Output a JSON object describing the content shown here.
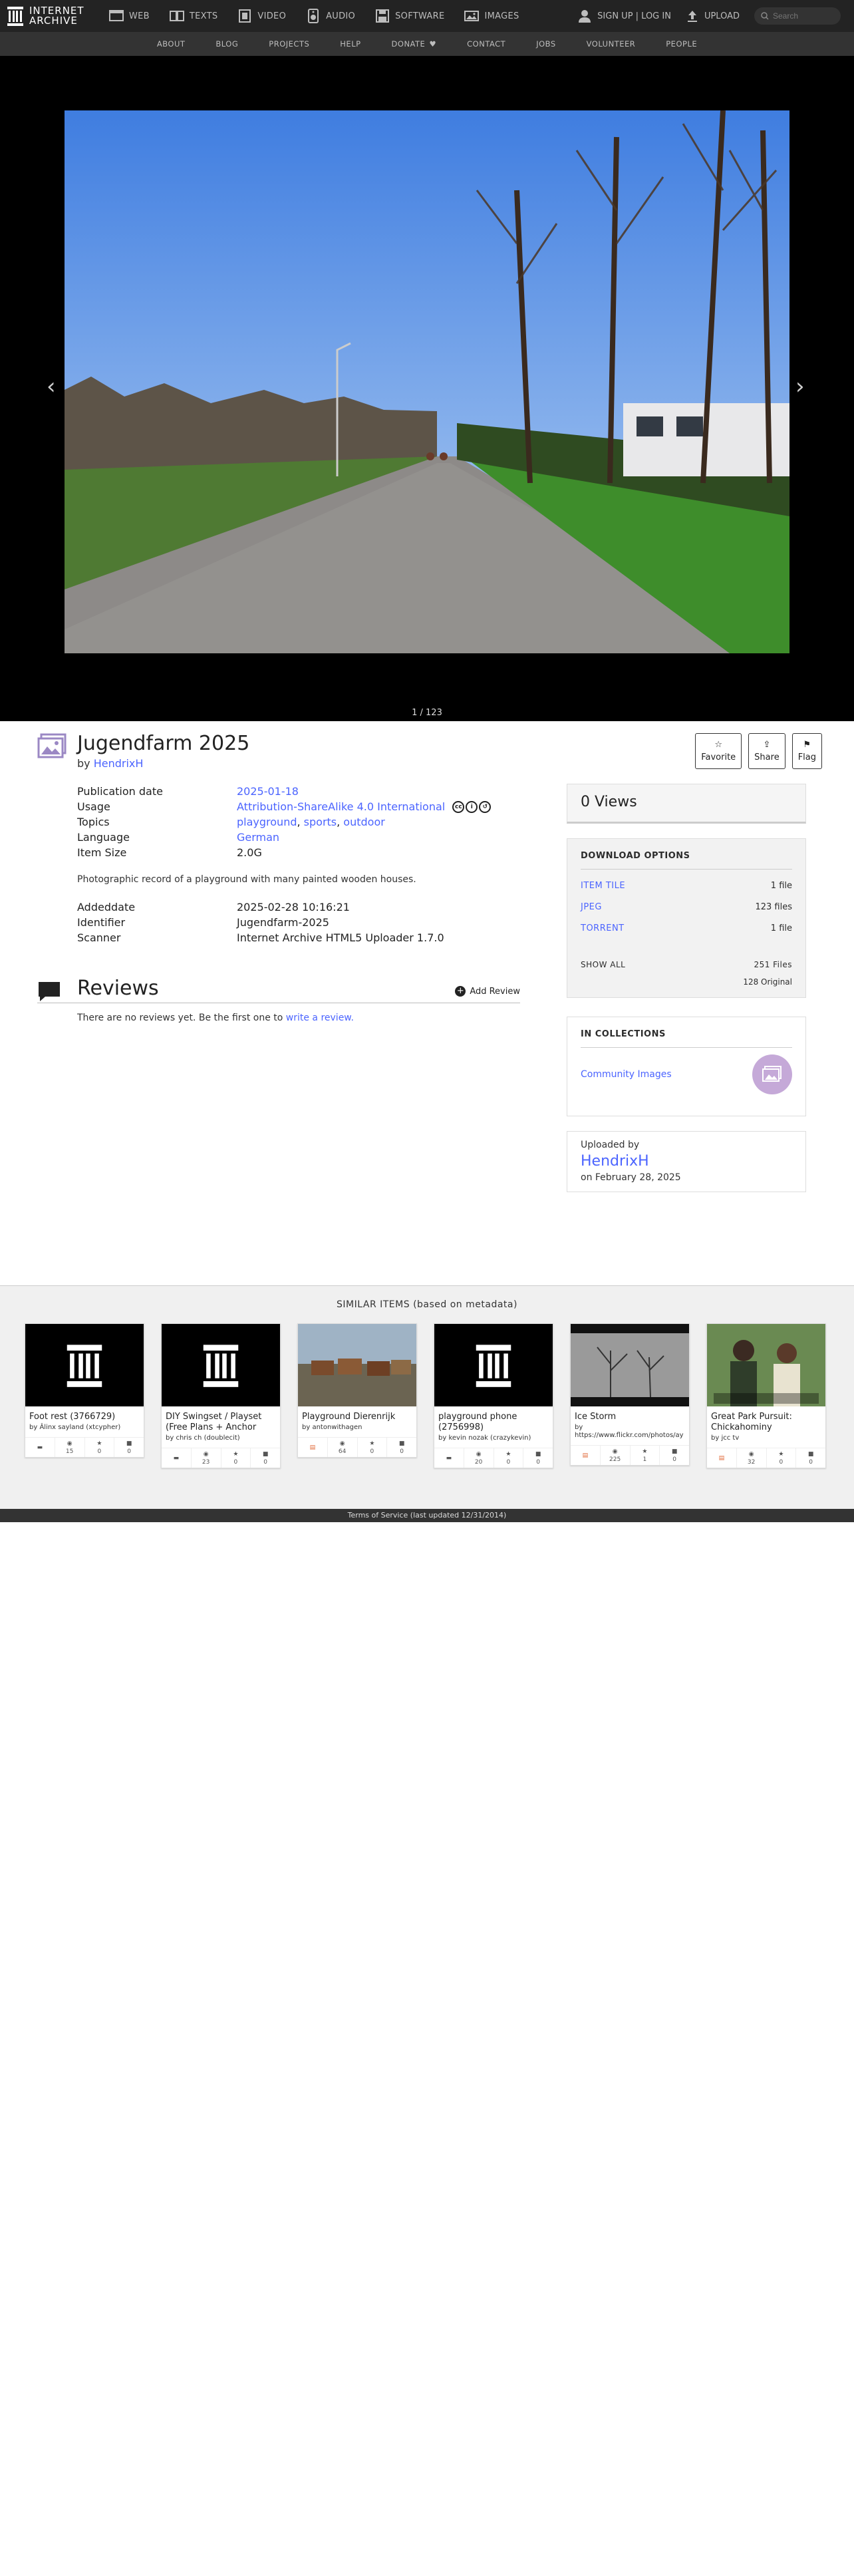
{
  "header": {
    "logo_line1": "INTERNET",
    "logo_line2": "ARCHIVE",
    "nav": [
      {
        "label": "WEB",
        "icon": "web-icon"
      },
      {
        "label": "TEXTS",
        "icon": "book-icon"
      },
      {
        "label": "VIDEO",
        "icon": "film-icon"
      },
      {
        "label": "AUDIO",
        "icon": "speaker-icon"
      },
      {
        "label": "SOFTWARE",
        "icon": "floppy-icon"
      },
      {
        "label": "IMAGES",
        "icon": "image-icon"
      }
    ],
    "signup": "SIGN UP | LOG IN",
    "upload": "UPLOAD",
    "search_placeholder": "Search"
  },
  "subnav": [
    "ABOUT",
    "BLOG",
    "PROJECTS",
    "HELP",
    "DONATE",
    "CONTACT",
    "JOBS",
    "VOLUNTEER",
    "PEOPLE"
  ],
  "theater": {
    "counter": "1 / 123"
  },
  "item": {
    "title": "Jugendfarm 2025",
    "by_prefix": "by",
    "author": "HendrixH",
    "actions": [
      "Favorite",
      "Share",
      "Flag"
    ]
  },
  "metadata": {
    "publication_date_label": "Publication date",
    "publication_date": "2025-01-18",
    "usage_label": "Usage",
    "usage": "Attribution-ShareAlike 4.0 International",
    "topics_label": "Topics",
    "topics": [
      "playground",
      "sports",
      "outdoor"
    ],
    "language_label": "Language",
    "language": "German",
    "item_size_label": "Item Size",
    "item_size": "2.0G",
    "description": "Photographic record of a playground with many painted wooden houses.",
    "addeddate_label": "Addeddate",
    "addeddate": "2025-02-28 10:16:21",
    "identifier_label": "Identifier",
    "identifier": "Jugendfarm-2025",
    "scanner_label": "Scanner",
    "scanner": "Internet Archive HTML5 Uploader 1.7.0"
  },
  "reviews": {
    "title": "Reviews",
    "add": "Add Review",
    "empty_text": "There are no reviews yet. Be the first one to",
    "empty_link": "write a review."
  },
  "views": "0 Views",
  "downloads": {
    "title": "DOWNLOAD OPTIONS",
    "rows": [
      {
        "label": "ITEM TILE",
        "count": "1 file"
      },
      {
        "label": "JPEG",
        "count": "123 files"
      },
      {
        "label": "TORRENT",
        "count": "1 file"
      }
    ],
    "show_all": "SHOW ALL",
    "total": "251 Files",
    "original": "128 Original"
  },
  "collections": {
    "title": "IN COLLECTIONS",
    "items": [
      "Community Images"
    ]
  },
  "uploader": {
    "label": "Uploaded by",
    "name": "HendrixH",
    "date": "on February 28, 2025"
  },
  "similar": {
    "title": "SIMILAR ITEMS (based on metadata)",
    "tiles": [
      {
        "title": "Foot rest (3766729)",
        "by": "by Âlinx sayland (xtcypher)",
        "views": "15",
        "favs": "0",
        "reviews": "0",
        "type": "folder"
      },
      {
        "title": "DIY Swingset / Playset (Free Plans + Anchor",
        "by": "by chris ch (doublecit)",
        "views": "23",
        "favs": "0",
        "reviews": "0",
        "type": "folder"
      },
      {
        "title": "Playground Dierenrijk",
        "by": "by antonwithagen",
        "views": "64",
        "favs": "0",
        "reviews": "0",
        "type": "film"
      },
      {
        "title": "playground phone (2756998)",
        "by": "by kevin nozak (crazykevin)",
        "views": "20",
        "favs": "0",
        "reviews": "0",
        "type": "folder"
      },
      {
        "title": "Ice Storm",
        "by": "by https://www.flickr.com/photos/ay",
        "views": "225",
        "favs": "1",
        "reviews": "0",
        "type": "film"
      },
      {
        "title": "Great Park Pursuit: Chickahominy",
        "by": "by jcc tv",
        "views": "32",
        "favs": "0",
        "reviews": "0",
        "type": "film"
      }
    ],
    "tile4_overlay": "..."
  },
  "footer": "Terms of Service (last updated 12/31/2014)"
}
